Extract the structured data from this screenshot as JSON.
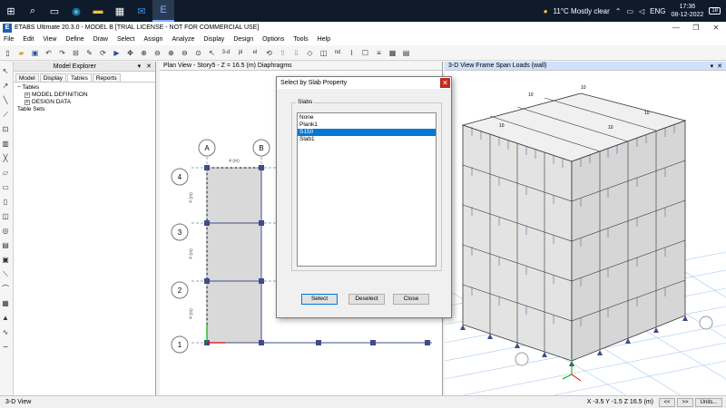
{
  "taskbar": {
    "weather": "11°C  Mostly clear",
    "language": "ENG",
    "time": "17:36",
    "date": "08-12-2022",
    "notif_count": "18"
  },
  "titlebar": {
    "title": "ETABS Ultimate 20.3.0 - MODEL B  [TRIAL LICENSE - NOT FOR COMMERCIAL USE]"
  },
  "menu": [
    "File",
    "Edit",
    "View",
    "Define",
    "Draw",
    "Select",
    "Assign",
    "Analyze",
    "Display",
    "Design",
    "Options",
    "Tools",
    "Help"
  ],
  "toolbar": {
    "btn_3d": "3-d",
    "btn_pl": "pl",
    "btn_el": "el",
    "btn_nd": "nd"
  },
  "explorer": {
    "title": "Model Explorer",
    "tabs": [
      "Model",
      "Display",
      "Tables",
      "Reports"
    ],
    "tree": {
      "root": "Tables",
      "item1": "MODEL DEFINITION",
      "item2": "DESIGN DATA",
      "item3": "Table Sets"
    }
  },
  "planview": {
    "title": "Plan View - Story5 - Z = 16.5 (m)  Diaphragms",
    "grid_cols": [
      "A",
      "B"
    ],
    "grid_rows": [
      "4",
      "3",
      "2",
      "1"
    ],
    "dim_label": "4 (m)"
  },
  "view3d": {
    "title": "3-D View  Frame Span Loads (wall)",
    "load_label": "10"
  },
  "dialog": {
    "title": "Select by Slab Property",
    "group_label": "Slabs",
    "items": [
      "None",
      "Plank1",
      "S150",
      "Slab1"
    ],
    "selected": "S150",
    "buttons": {
      "select": "Select",
      "deselect": "Deselect",
      "close": "Close"
    }
  },
  "status": {
    "view_name": "3-D View",
    "coords": "X -3.5  Y -1.5  Z 16.5 (m)",
    "prev": "<<",
    "next": ">>",
    "units": "Units..."
  },
  "colors": {
    "accent": "#0078d7",
    "slab_fill": "#d9d9d9",
    "grid_line": "#9aa5b8",
    "joint": "#3f4d8c"
  }
}
